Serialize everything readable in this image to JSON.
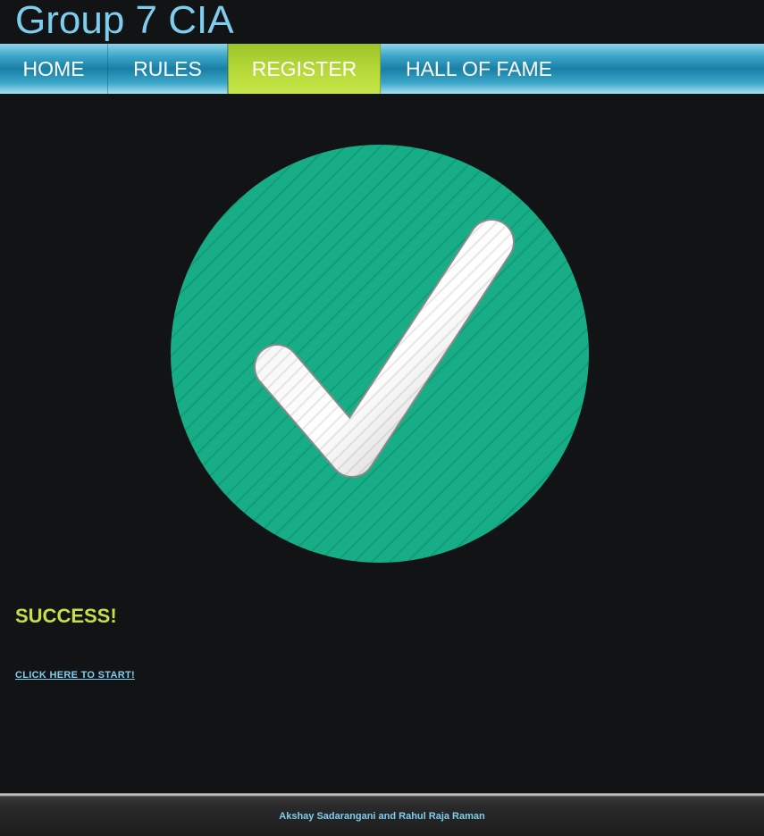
{
  "header": {
    "site_title": "Group 7 CIA"
  },
  "nav": {
    "items": [
      {
        "label": "HOME",
        "active": false
      },
      {
        "label": "RULES",
        "active": false
      },
      {
        "label": "REGISTER",
        "active": true
      },
      {
        "label": "HALL OF FAME",
        "active": false
      }
    ]
  },
  "main": {
    "icon": "checkmark-circle-icon",
    "heading": "SUCCESS!",
    "link_label": "CLICK HERE TO START!"
  },
  "footer": {
    "credits": "Akshay Sadarangani and Rahul Raja Raman"
  },
  "colors": {
    "title": "#7fcdee",
    "nav_accent": "#b5d838",
    "success_circle": "#16ad87",
    "success_text": "#c2e04a",
    "link": "#7fcdee",
    "background": "#121314"
  }
}
